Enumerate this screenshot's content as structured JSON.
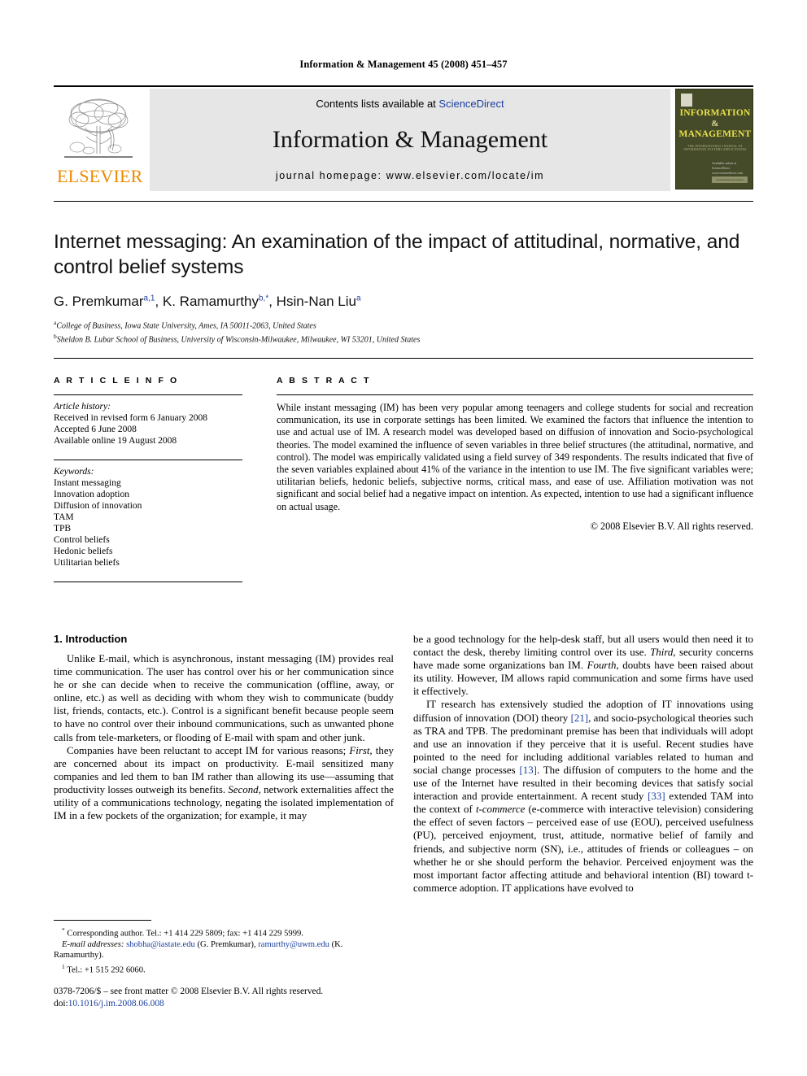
{
  "running_head": "Information & Management 45 (2008) 451–457",
  "masthead": {
    "contents_prefix": "Contents lists available at ",
    "contents_link": "ScienceDirect",
    "journal_name": "Information & Management",
    "homepage": "journal homepage: www.elsevier.com/locate/im",
    "publisher_wordmark": "ELSEVIER",
    "cover": {
      "line1": "INFORMATION",
      "amp": "&",
      "line2": "MANAGEMENT",
      "subtitle": "THE INTERNATIONAL JOURNAL OF INFORMATION SYSTEMS APPLICATIONS",
      "sciencedirect": "Available online at\nScienceDirect\nwww.sciencedirect.com",
      "footer": "An international journal"
    }
  },
  "article": {
    "title": "Internet messaging: An examination of the impact of attitudinal, normative, and control belief systems",
    "authors": [
      {
        "name": "G. Premkumar",
        "marks": "a,1"
      },
      {
        "name": "K. Ramamurthy",
        "marks": "b,*"
      },
      {
        "name": "Hsin-Nan Liu",
        "marks": "a"
      }
    ],
    "affiliations": [
      {
        "mark": "a",
        "text": "College of Business, Iowa State University, Ames, IA 50011-2063, United States"
      },
      {
        "mark": "b",
        "text": "Sheldon B. Lubar School of Business, University of Wisconsin-Milwaukee, Milwaukee, WI 53201, United States"
      }
    ]
  },
  "article_info": {
    "heading": "A R T I C L E   I N F O",
    "history_label": "Article history:",
    "history": [
      "Received in revised form 6 January 2008",
      "Accepted 6 June 2008",
      "Available online 19 August 2008"
    ],
    "keywords_label": "Keywords:",
    "keywords": [
      "Instant messaging",
      "Innovation adoption",
      "Diffusion of innovation",
      "TAM",
      "TPB",
      "Control beliefs",
      "Hedonic beliefs",
      "Utilitarian beliefs"
    ]
  },
  "abstract": {
    "heading": "A B S T R A C T",
    "text": "While instant messaging (IM) has been very popular among teenagers and college students for social and recreation communication, its use in corporate settings has been limited. We examined the factors that influence the intention to use and actual use of IM. A research model was developed based on diffusion of innovation and Socio-psychological theories. The model examined the influence of seven variables in three belief structures (the attitudinal, normative, and control). The model was empirically validated using a field survey of 349 respondents. The results indicated that five of the seven variables explained about 41% of the variance in the intention to use IM. The five significant variables were; utilitarian beliefs, hedonic beliefs, subjective norms, critical mass, and ease of use. Affiliation motivation was not significant and social belief had a negative impact on intention. As expected, intention to use had a significant influence on actual usage.",
    "copyright": "© 2008 Elsevier B.V. All rights reserved."
  },
  "body": {
    "section_heading": "1. Introduction",
    "left_paragraphs": [
      "Unlike E-mail, which is asynchronous, instant messaging (IM) provides real time communication. The user has control over his or her communication since he or she can decide when to receive the communication (offline, away, or online, etc.) as well as deciding with whom they wish to communicate (buddy list, friends, contacts, etc.). Control is a significant benefit because people seem to have no control over their inbound communications, such as unwanted phone calls from tele-marketers, or flooding of E-mail with spam and other junk."
    ],
    "left_paragraph_2_parts": {
      "a": "Companies have been reluctant to accept IM for various reasons; ",
      "first": "First,",
      "b": " they are concerned about its impact on productivity. E-mail sensitized many companies and led them to ban IM rather than allowing its use—assuming that productivity losses outweigh its benefits. ",
      "second": "Second,",
      "c": " network externalities affect the utility of a communications technology, negating the isolated implementation of IM in a few pockets of the organization; for example, it may"
    },
    "right_paragraph_1_parts": {
      "a": "be a good technology for the help-desk staff, but all users would then need it to contact the desk, thereby limiting control over its use. ",
      "third": "Third,",
      "b": " security concerns have made some organizations ban IM. ",
      "fourth": "Fourth,",
      "c": " doubts have been raised about its utility. However, IM allows rapid communication and some firms have used it effectively."
    },
    "right_paragraph_2_parts": {
      "a": "IT research has extensively studied the adoption of IT innovations using diffusion of innovation (DOI) theory ",
      "ref21": "[21]",
      "b": ", and socio-psychological theories such as TRA and TPB. The predominant premise has been that individuals will adopt and use an innovation if they perceive that it is useful. Recent studies have pointed to the need for including additional variables related to human and social change processes ",
      "ref13": "[13]",
      "c": ". The diffusion of computers to the home and the use of the Internet have resulted in their becoming devices that satisfy social interaction and provide entertainment. A recent study ",
      "ref33": "[33]",
      "d": " extended TAM into the context of ",
      "tcommerce": "t-commerce",
      "e": " (e-commerce with interactive television) considering the effect of seven factors – perceived ease of use (EOU), perceived usefulness (PU), perceived enjoyment, trust, attitude, normative belief of family and friends, and subjective norm (SN), i.e., attitudes of friends or colleagues – on whether he or she should perform the behavior. Perceived enjoyment was the most important factor affecting attitude and behavioral intention (BI) toward t-commerce adoption. IT applications have evolved to"
    }
  },
  "footnotes": {
    "corresponding_mark": "*",
    "corresponding": "Corresponding author. Tel.: +1 414 229 5809; fax: +1 414 229 5999.",
    "email_label": "E-mail addresses:",
    "email1": "shobha@iastate.edu",
    "email1_owner": "(G. Premkumar),",
    "email2": "ramurthy@uwm.edu",
    "email2_owner": "(K. Ramamurthy).",
    "note1_mark": "1",
    "note1": "Tel.: +1 515 292 6060."
  },
  "imprint": {
    "line1": "0378-7206/$ – see front matter © 2008 Elsevier B.V. All rights reserved.",
    "doi_label": "doi:",
    "doi": "10.1016/j.im.2008.06.008"
  },
  "colors": {
    "elsevier_orange": "#ED8B00",
    "link_blue": "#1a3fa0",
    "band_gray": "#e6e6e6",
    "cover_green": "#454a28",
    "cover_yellow": "#e8e24a"
  }
}
